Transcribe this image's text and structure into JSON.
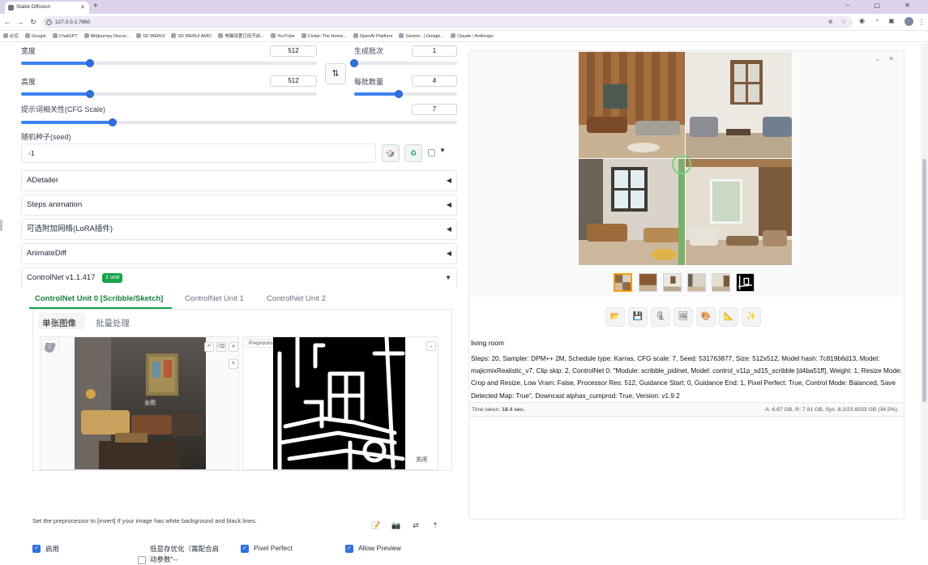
{
  "browser": {
    "tab_title": "Stable Diffusion",
    "new_tab": "+",
    "window_controls": "– ▢ ✕",
    "url": "127.0.0.1:7860",
    "bookmarks": [
      "必应",
      "Google",
      "ChatGPT",
      "Midjourney Discor...",
      "SD WEBUI",
      "SD WEBUI AMIC",
      "电脑设置已经开启...",
      "YouTube",
      "Civitai: The Home...",
      "OpenAI Platform",
      "Gemini - | Google...",
      "Claude \\ Anthropic"
    ]
  },
  "left": {
    "width": {
      "label": "宽度",
      "value": "512",
      "fraction": 0.233
    },
    "height": {
      "label": "高度",
      "value": "512",
      "fraction": 0.233
    },
    "batch_count": {
      "label": "生成批次",
      "value": "1",
      "fraction": 0.0
    },
    "batch_size": {
      "label": "每批数量",
      "value": "4",
      "fraction": 0.43
    },
    "cfg": {
      "label": "提示词相关性(CFG Scale)",
      "value": "7",
      "fraction": 0.21
    },
    "swap_icon": "⇅",
    "seed": {
      "label": "随机种子(seed)",
      "value": "-1",
      "dice": "🎲",
      "recycle": "♻",
      "caret": "▼"
    },
    "accordions": [
      {
        "label": "ADetailer",
        "caret": "◀"
      },
      {
        "label": "Steps animation",
        "caret": "◀"
      },
      {
        "label": "可选附加网络(LoRA插件)",
        "caret": "◀"
      },
      {
        "label": "AnimateDiff",
        "caret": "◀"
      }
    ],
    "controlnet": {
      "title": "ControlNet v1.1.417",
      "badge": "1 unit",
      "caret": "▼",
      "tabs": [
        "ControlNet Unit 0 [Scribble/Sketch]",
        "ControlNet Unit 1",
        "ControlNet Unit 2"
      ],
      "subtabs": [
        "单张图像",
        "批量处理"
      ],
      "image_label": "图像",
      "image_overlay": "全图",
      "preprocessor_label": "Preprocessor Preview",
      "close_label": "关闭",
      "note": "Set the preprocessor to [invert] If your image has white background and black lines.",
      "checkboxes": [
        {
          "label": "启用",
          "checked": true
        },
        {
          "label": "低显存优化（需配合启动参数\"--",
          "checked": false
        },
        {
          "label": "Pixel Perfect",
          "checked": true
        },
        {
          "label": "Allow Preview",
          "checked": true
        }
      ]
    }
  },
  "right": {
    "prompt": "living room",
    "params": "Steps: 20, Sampler: DPM++ 2M, Schedule type: Karras, CFG scale: 7, Seed: 531763877, Size: 512x512, Model hash: 7c819b6d13, Model: majicmixRealistic_v7, Clip skip: 2, ControlNet 0: \"Module: scribble_pidinet, Model: control_v11p_sd15_scribble [d4ba51ff], Weight: 1, Resize Mode: Crop and Resize, Low Vram: False, Processor Res: 512, Guidance Start: 0, Guidance End: 1, Pixel Perfect: True, Control Mode: Balanced, Save Detected Map: True\", Downcast alphas_cumprod: True, Version: v1.9.2",
    "time_taken_label": "Time taken:",
    "time_taken": "18.4 sec.",
    "vram": "A: 6.67 GB, R: 7.91 GB, Sys: 8.2/23.6533 GB (34.5%)",
    "tools": [
      "📂",
      "💾",
      "🗜",
      "🖼",
      "🎨",
      "📐",
      "✨"
    ]
  },
  "colors": {
    "accent": "#2f6fde",
    "green": "#16a34a"
  }
}
